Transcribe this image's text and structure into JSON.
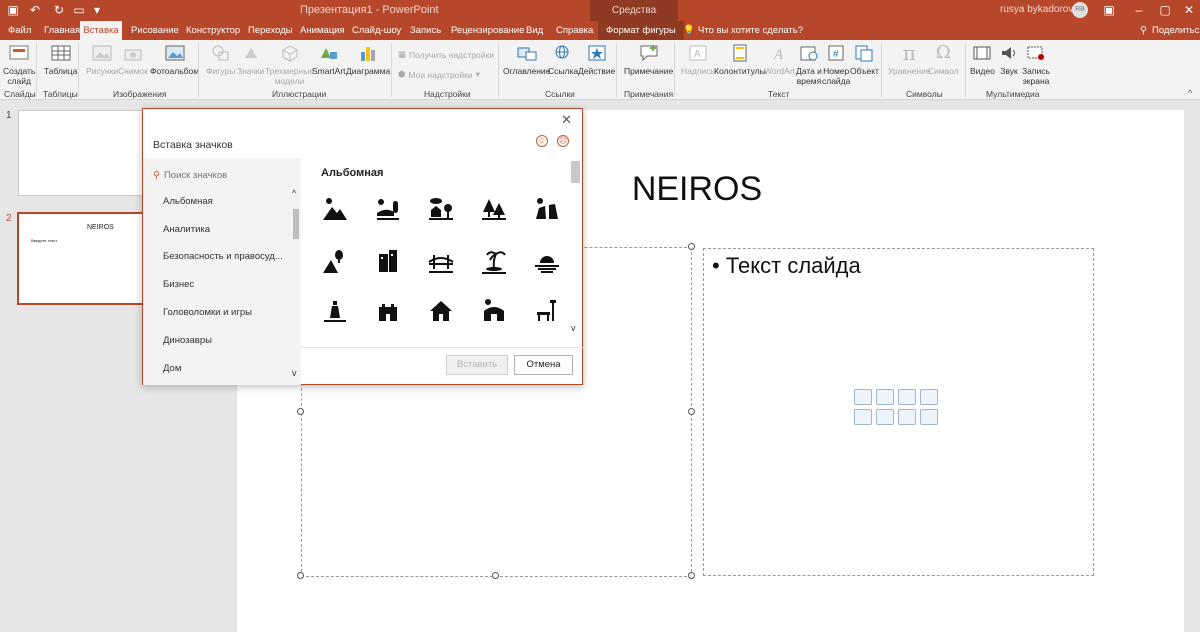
{
  "window": {
    "title": "Презентация1  -  PowerPoint",
    "context_title": "Средства рисования",
    "user": "rusya bykadorov",
    "user_initials": "RB"
  },
  "tabs": [
    {
      "label": "Файл"
    },
    {
      "label": "Главная"
    },
    {
      "label": "Вставка"
    },
    {
      "label": "Рисование"
    },
    {
      "label": "Конструктор"
    },
    {
      "label": "Переходы"
    },
    {
      "label": "Анимация"
    },
    {
      "label": "Слайд-шоу"
    },
    {
      "label": "Запись"
    },
    {
      "label": "Рецензирование"
    },
    {
      "label": "Вид"
    },
    {
      "label": "Справка"
    },
    {
      "label": "Формат фигуры"
    }
  ],
  "tell_me": "Что вы хотите сделать?",
  "share": "Поделиться",
  "ribbon": {
    "slides": {
      "new_slide": "Создать",
      "new_slide2": "слайд",
      "group": "Слайды"
    },
    "tables": {
      "table": "Таблица",
      "group": "Таблицы"
    },
    "images": {
      "pictures": "Рисунки",
      "screenshot": "Снимок",
      "album": "Фотоальбом",
      "group": "Изображения"
    },
    "illustrations": {
      "shapes": "Фигуры",
      "icons": "Значки",
      "models": "Трехмерные",
      "models2": "модели",
      "smartart": "SmartArt",
      "chart": "Диаграмма",
      "group": "Иллюстрации"
    },
    "addins": {
      "get": "Получить надстройки",
      "my": "Мои надстройки",
      "group": "Надстройки"
    },
    "links": {
      "zoom": "Оглавление",
      "link": "Ссылка",
      "action": "Действие",
      "group": "Ссылки"
    },
    "comments": {
      "comment": "Примечание",
      "group": "Примечания"
    },
    "text": {
      "textbox": "Надпись",
      "header": "Колонтитулы",
      "wordart": "WordArt",
      "date": "Дата и",
      "date2": "время",
      "slidenum": "Номер",
      "slidenum2": "слайда",
      "object": "Объект",
      "group": "Текст"
    },
    "symbols": {
      "equation": "Уравнение",
      "symbol": "Символ",
      "group": "Символы"
    },
    "media": {
      "video": "Видео",
      "audio": "Звук",
      "record": "Запись",
      "record2": "экрана",
      "group": "Мультимедиа"
    }
  },
  "thumbnails": [
    {
      "number": "1"
    },
    {
      "number": "2",
      "title": "NEIROS",
      "text": "Введите текст"
    }
  ],
  "slide": {
    "title": "NEIROS",
    "bullet": "• Текст слайда"
  },
  "dialog": {
    "title": "Вставка значков",
    "search_placeholder": "Поиск значков",
    "categories": [
      "Альбомная",
      "Аналитика",
      "Безопасность и правосуд...",
      "Бизнес",
      "Головоломки и игры",
      "Динозавры",
      "Дом"
    ],
    "section_title": "Альбомная",
    "icons": [
      "mountains-sun-icon",
      "sunrise-river-icon",
      "house-tree-cloud-icon",
      "pine-trees-icon",
      "waterfall-icon",
      "balloon-mountain-icon",
      "skyscraper-icon",
      "bridge-icon",
      "palm-island-icon",
      "sunset-sea-icon",
      "lighthouse-icon",
      "castle-icon",
      "house-icon",
      "barn-icon",
      "park-bench-icon"
    ],
    "insert": "Вставить",
    "cancel": "Отмена"
  }
}
